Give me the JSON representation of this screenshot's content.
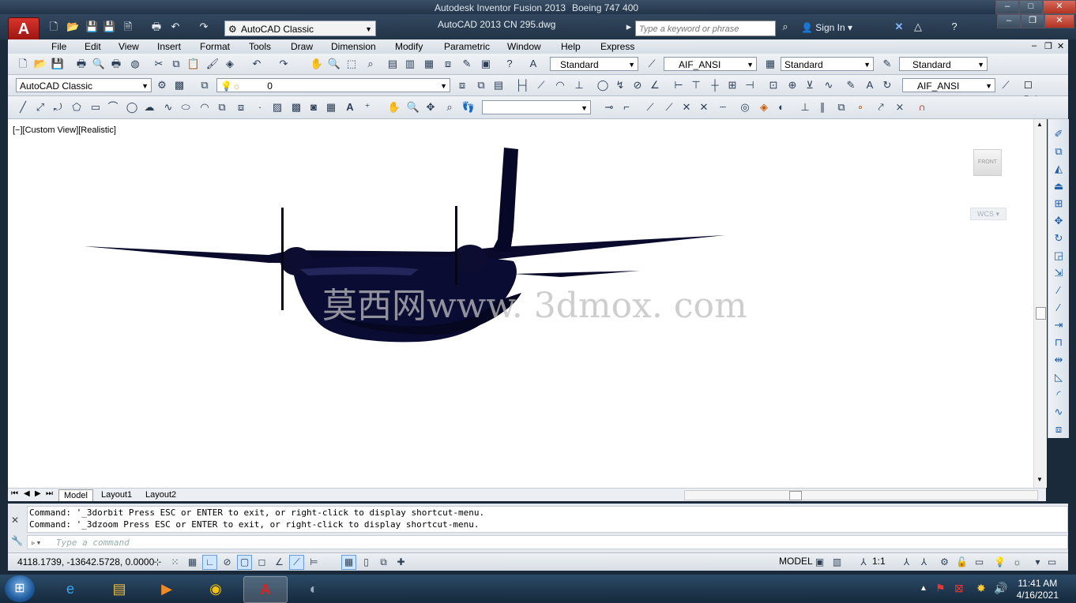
{
  "outer_window": {
    "title": "Autodesk Inventor Fusion 2013",
    "subtitle": "Boeing 747 400"
  },
  "acad": {
    "app_button": "A",
    "workspace": "AutoCAD Classic",
    "document_title": "AutoCAD 2013     CN 295.dwg",
    "search_placeholder": "Type a keyword or phrase",
    "sign_in": "Sign In"
  },
  "menu": [
    "File",
    "Edit",
    "View",
    "Insert",
    "Format",
    "Tools",
    "Draw",
    "Dimension",
    "Modify",
    "Parametric",
    "Window",
    "Help",
    "Express"
  ],
  "styles_toolbar": {
    "text_style": "Standard",
    "dim_style": "AIF_ANSI",
    "table_style": "Standard",
    "multileader_style": "Standard"
  },
  "layers_toolbar": {
    "workspace": "AutoCAD Classic",
    "layer": "0",
    "dim_style2": "AIF_ANSI",
    "color": "ByLayer"
  },
  "drawing": {
    "view_label": "[−][Custom View][Realistic]",
    "viewcube_face": "FRONT",
    "ucs_label": "WCS",
    "watermark": "莫西网www. 3dmox. com"
  },
  "layout_tabs": [
    "Model",
    "Layout1",
    "Layout2"
  ],
  "command": {
    "history": [
      "Command: '_3dorbit Press ESC or ENTER to exit, or right-click to display shortcut-menu.",
      "Command: '_3dzoom Press ESC or ENTER to exit, or right-click to display shortcut-menu."
    ],
    "input_placeholder": "Type a command"
  },
  "status": {
    "coordinates": "4118.1739, -13642.5728, 0.0000",
    "space": "MODEL",
    "annotation_scale": "1:1"
  },
  "taskbar": {
    "time": "11:41 AM",
    "date": "4/16/2021"
  },
  "colors": {
    "aircraft": "#0a0b2e",
    "canvas": "#ffffff",
    "title_bar": "#2a3d52"
  }
}
